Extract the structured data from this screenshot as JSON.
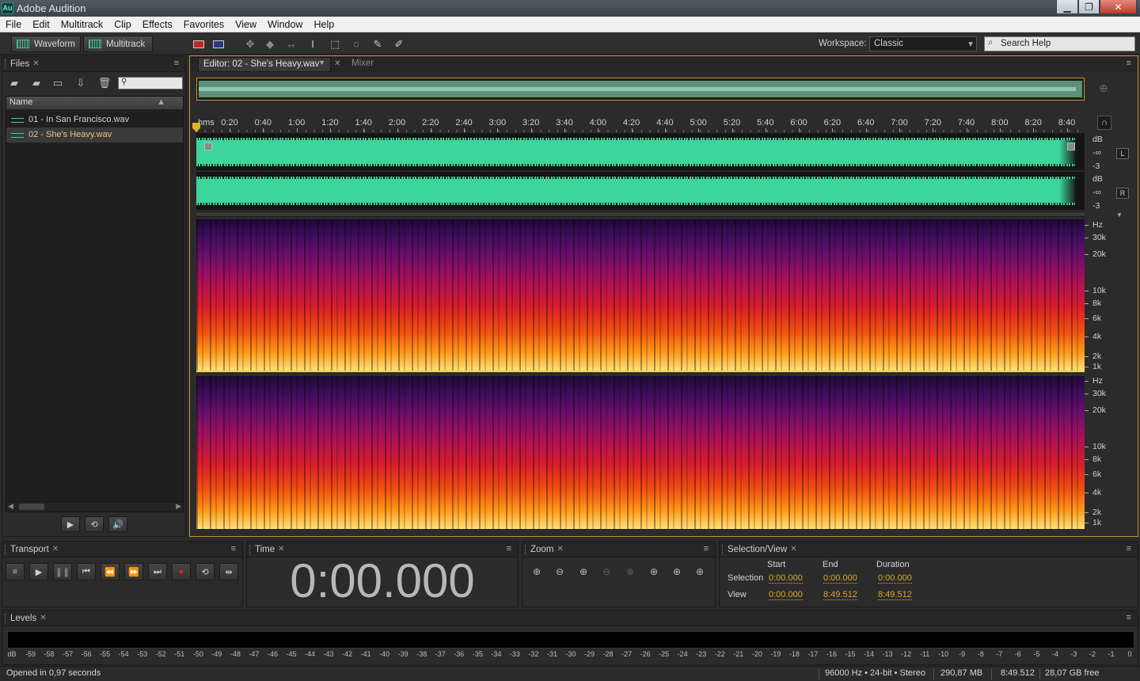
{
  "window": {
    "title": "Adobe Audition",
    "logo": "Au"
  },
  "menubar": [
    "File",
    "Edit",
    "Multitrack",
    "Clip",
    "Effects",
    "Favorites",
    "View",
    "Window",
    "Help"
  ],
  "toolbar": {
    "waveform_label": "Waveform",
    "multitrack_label": "Multitrack",
    "workspace_label": "Workspace:",
    "workspace_value": "Classic",
    "search_placeholder": "Search Help"
  },
  "files_panel": {
    "title": "Files",
    "column_name": "Name",
    "files": [
      {
        "name": "01 - In San Francisco.wav",
        "selected": false
      },
      {
        "name": "02 - She's Heavy.wav",
        "selected": true
      }
    ]
  },
  "editor": {
    "tab_label": "Editor: 02 - She's Heavy.wav",
    "mixer_label": "Mixer",
    "ruler_unit": "hms",
    "ruler_labels": [
      "0:20",
      "0:40",
      "1:00",
      "1:20",
      "1:40",
      "2:00",
      "2:20",
      "2:40",
      "3:00",
      "3:20",
      "3:40",
      "4:00",
      "4:20",
      "4:40",
      "5:00",
      "5:20",
      "5:40",
      "6:00",
      "6:20",
      "6:40",
      "7:00",
      "7:20",
      "7:40",
      "8:00",
      "8:20",
      "8:40"
    ],
    "db_scale": {
      "unit": "dB",
      "top": "-∞",
      "bottom": "-3"
    },
    "channels": [
      "L",
      "R"
    ],
    "hz_scale": {
      "unit": "Hz",
      "labels": [
        "30k",
        "20k",
        "10k",
        "8k",
        "6k",
        "4k",
        "2k",
        "1k"
      ]
    }
  },
  "transport": {
    "title": "Transport"
  },
  "time_panel": {
    "title": "Time",
    "value": "0:00.000"
  },
  "zoom_panel": {
    "title": "Zoom"
  },
  "selection_view": {
    "title": "Selection/View",
    "headers": [
      "Start",
      "End",
      "Duration"
    ],
    "selection_label": "Selection",
    "view_label": "View",
    "selection": {
      "start": "0:00.000",
      "end": "0:00.000",
      "duration": "0:00.000"
    },
    "view": {
      "start": "0:00.000",
      "end": "8:49.512",
      "duration": "8:49.512"
    }
  },
  "levels": {
    "title": "Levels",
    "scale": [
      "dB",
      "-59",
      "-58",
      "-57",
      "-56",
      "-55",
      "-54",
      "-53",
      "-52",
      "-51",
      "-50",
      "-49",
      "-48",
      "-47",
      "-46",
      "-45",
      "-44",
      "-43",
      "-42",
      "-41",
      "-40",
      "-39",
      "-38",
      "-37",
      "-36",
      "-35",
      "-34",
      "-33",
      "-32",
      "-31",
      "-30",
      "-29",
      "-28",
      "-27",
      "-26",
      "-25",
      "-24",
      "-23",
      "-22",
      "-21",
      "-20",
      "-19",
      "-18",
      "-17",
      "-16",
      "-15",
      "-14",
      "-13",
      "-12",
      "-11",
      "-10",
      "-9",
      "-8",
      "-7",
      "-6",
      "-5",
      "-4",
      "-3",
      "-2",
      "-1",
      "0"
    ]
  },
  "status": {
    "message": "Opened in 0,97 seconds",
    "format": "96000 Hz • 24-bit • Stereo",
    "size": "290,87 MB",
    "duration": "8:49.512",
    "free": "28,07 GB free"
  },
  "colors": {
    "accent": "#c8962c",
    "waveform": "#3ed59a",
    "time_values": "#e2a427"
  }
}
